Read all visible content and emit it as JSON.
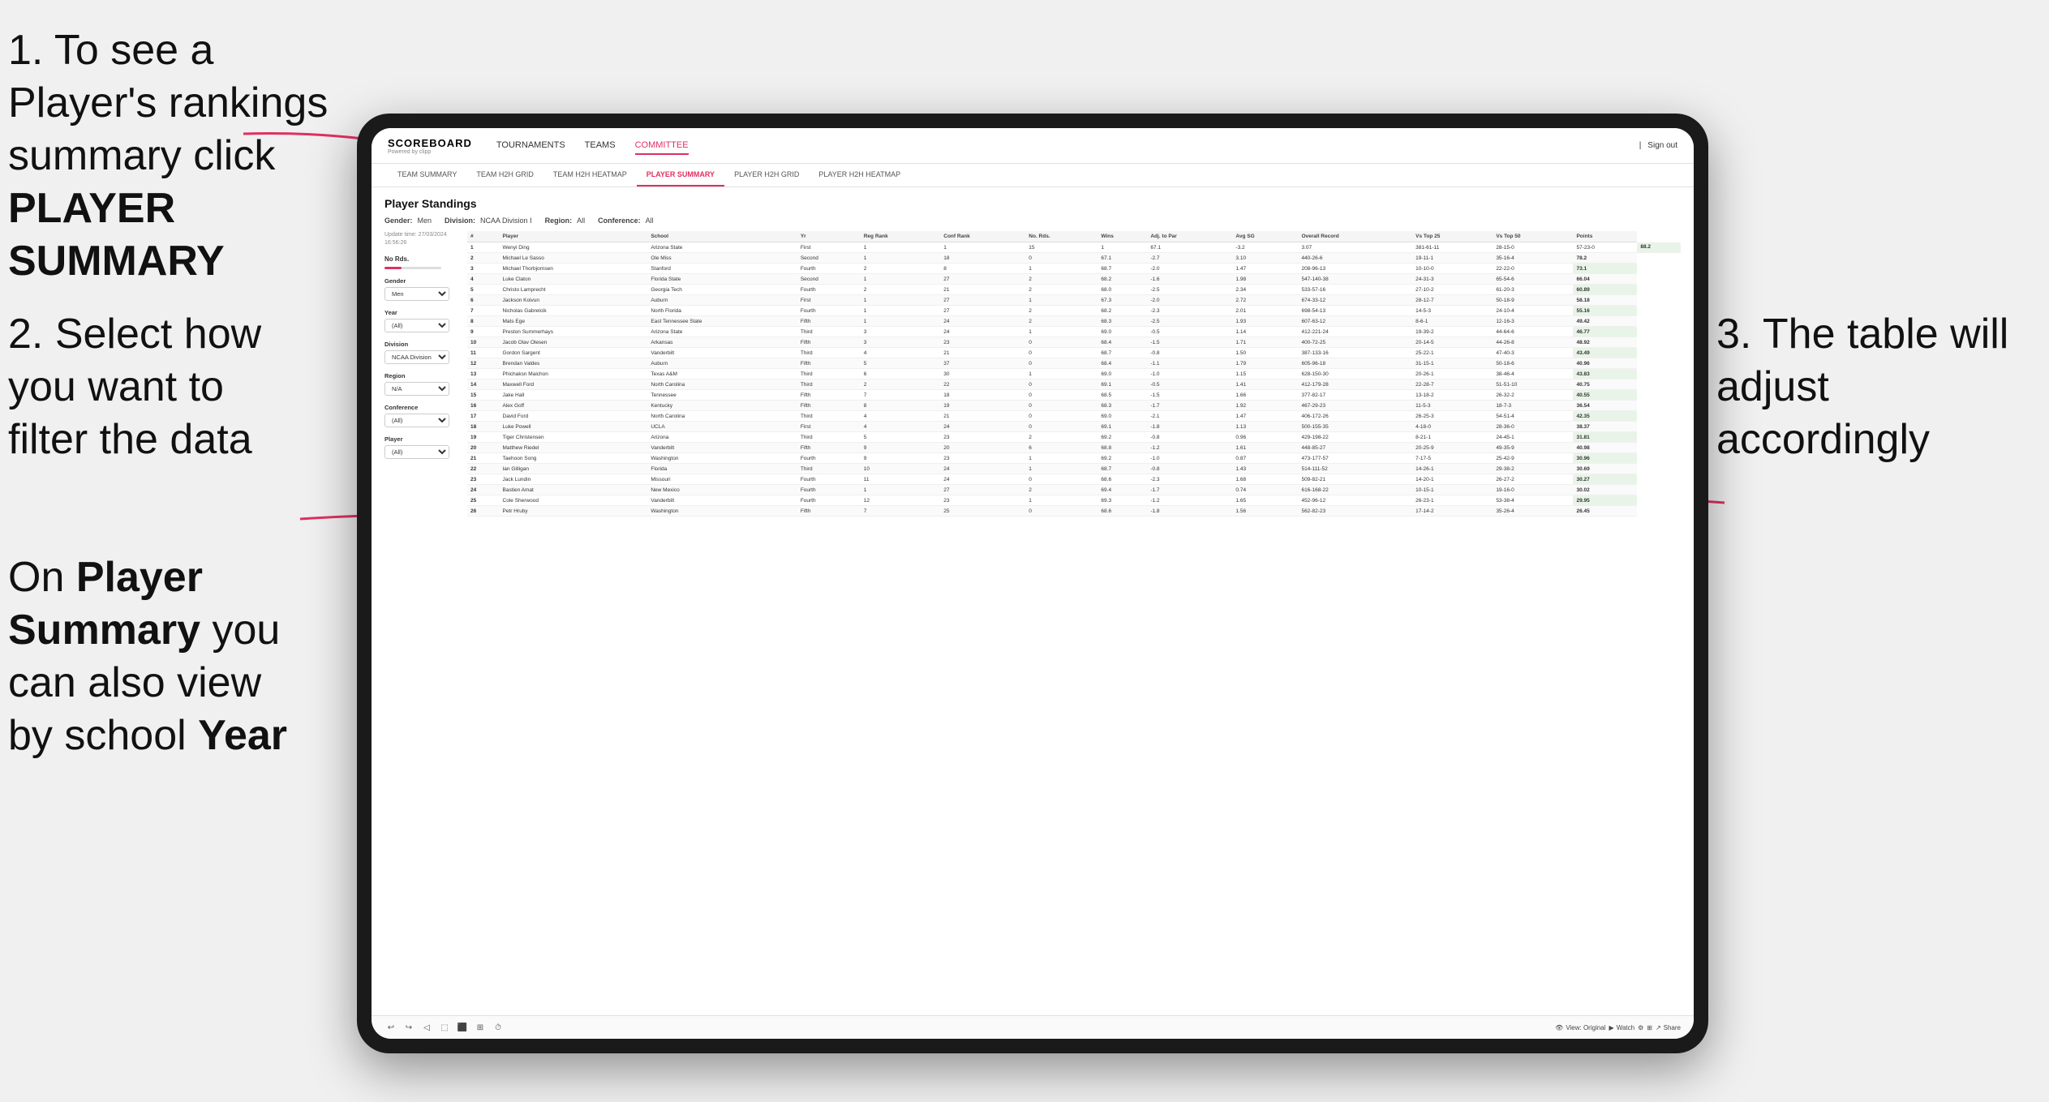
{
  "instructions": {
    "step1": {
      "number": "1.",
      "text": "To see a Player's rankings summary click ",
      "bold": "PLAYER SUMMARY"
    },
    "step2": {
      "number": "2.",
      "text": "Select how you want to filter the data"
    },
    "step3_sub": {
      "text": "On ",
      "bold1": "Player Summary",
      "text2": " you can also view by school ",
      "bold2": "Year"
    },
    "step_right": {
      "number": "3.",
      "text": "The table will adjust accordingly"
    }
  },
  "app": {
    "logo": "SCOREBOARD",
    "logo_sub": "Powered by clipp",
    "sign_out": "Sign out",
    "nav": [
      {
        "label": "TOURNAMENTS",
        "active": false
      },
      {
        "label": "TEAMS",
        "active": false
      },
      {
        "label": "COMMITTEE",
        "active": true
      }
    ],
    "sub_nav": [
      {
        "label": "TEAM SUMMARY",
        "active": false
      },
      {
        "label": "TEAM H2H GRID",
        "active": false
      },
      {
        "label": "TEAM H2H HEATMAP",
        "active": false
      },
      {
        "label": "PLAYER SUMMARY",
        "active": true
      },
      {
        "label": "PLAYER H2H GRID",
        "active": false
      },
      {
        "label": "PLAYER H2H HEATMAP",
        "active": false
      }
    ]
  },
  "page": {
    "title": "Player Standings",
    "filters_row": {
      "gender_label": "Gender:",
      "gender_value": "Men",
      "division_label": "Division:",
      "division_value": "NCAA Division I",
      "region_label": "Region:",
      "region_value": "All",
      "conference_label": "Conference:",
      "conference_value": "All"
    },
    "update_time": "Update time:\n27/03/2024 16:56:26",
    "sidebar": {
      "rds_label": "No Rds.",
      "gender_label": "Gender",
      "gender_value": "Men",
      "year_label": "Year",
      "year_value": "(All)",
      "division_label": "Division",
      "division_value": "NCAA Division I",
      "region_label": "Region",
      "region_value": "N/A",
      "conference_label": "Conference",
      "conference_value": "(All)",
      "player_label": "Player",
      "player_value": "(All)"
    },
    "table": {
      "headers": [
        "#",
        "Player",
        "School",
        "Yr",
        "Reg Rank",
        "Conf Rank",
        "No. Rds.",
        "Wins",
        "Adj. to Par",
        "Avg SG",
        "Overall Record",
        "Vs Top 25",
        "Vs Top 50",
        "Points"
      ],
      "rows": [
        [
          "1",
          "Wenyi Ding",
          "Arizona State",
          "First",
          "1",
          "1",
          "15",
          "1",
          "67.1",
          "-3.2",
          "3.07",
          "381-61-11",
          "28-15-0",
          "57-23-0",
          "88.2"
        ],
        [
          "2",
          "Michael Le Sasso",
          "Ole Miss",
          "Second",
          "1",
          "18",
          "0",
          "67.1",
          "-2.7",
          "3.10",
          "440-26-6",
          "19-11-1",
          "35-16-4",
          "78.2"
        ],
        [
          "3",
          "Michael Thorbjornsen",
          "Stanford",
          "Fourth",
          "2",
          "8",
          "1",
          "68.7",
          "-2.0",
          "1.47",
          "208-96-13",
          "10-10-0",
          "22-22-0",
          "73.1"
        ],
        [
          "4",
          "Luke Claton",
          "Florida State",
          "Second",
          "1",
          "27",
          "2",
          "68.2",
          "-1.6",
          "1.98",
          "547-140-38",
          "24-31-3",
          "65-54-6",
          "66.04"
        ],
        [
          "5",
          "Christo Lamprecht",
          "Georgia Tech",
          "Fourth",
          "2",
          "21",
          "2",
          "68.0",
          "-2.5",
          "2.34",
          "533-57-16",
          "27-10-2",
          "61-20-3",
          "60.89"
        ],
        [
          "6",
          "Jackson Koivun",
          "Auburn",
          "First",
          "1",
          "27",
          "1",
          "67.3",
          "-2.0",
          "2.72",
          "674-33-12",
          "28-12-7",
          "50-18-9",
          "58.18"
        ],
        [
          "7",
          "Nicholas Gabrelcik",
          "North Florida",
          "Fourth",
          "1",
          "27",
          "2",
          "68.2",
          "-2.3",
          "2.01",
          "698-54-13",
          "14-5-3",
          "24-10-4",
          "55.16"
        ],
        [
          "8",
          "Mats Ege",
          "East Tennessee State",
          "Fifth",
          "1",
          "24",
          "2",
          "68.3",
          "-2.5",
          "1.93",
          "607-63-12",
          "8-6-1",
          "12-16-3",
          "49.42"
        ],
        [
          "9",
          "Preston Summerhays",
          "Arizona State",
          "Third",
          "3",
          "24",
          "1",
          "69.0",
          "-0.5",
          "1.14",
          "412-221-24",
          "19-39-2",
          "44-64-6",
          "46.77"
        ],
        [
          "10",
          "Jacob Olav Olesen",
          "Arkansas",
          "Fifth",
          "3",
          "23",
          "0",
          "68.4",
          "-1.5",
          "1.71",
          "400-72-25",
          "20-14-5",
          "44-26-8",
          "48.92"
        ],
        [
          "11",
          "Gordon Sargent",
          "Vanderbilt",
          "Third",
          "4",
          "21",
          "0",
          "68.7",
          "-0.8",
          "1.50",
          "387-133-16",
          "25-22-1",
          "47-40-3",
          "43.49"
        ],
        [
          "12",
          "Brendan Valdes",
          "Auburn",
          "Fifth",
          "5",
          "37",
          "0",
          "68.4",
          "-1.1",
          "1.79",
          "605-96-18",
          "31-15-1",
          "50-18-6",
          "40.96"
        ],
        [
          "13",
          "Phichaksn Maichon",
          "Texas A&M",
          "Third",
          "6",
          "30",
          "1",
          "69.0",
          "-1.0",
          "1.15",
          "628-150-30",
          "20-26-1",
          "38-46-4",
          "43.83"
        ],
        [
          "14",
          "Maxwell Ford",
          "North Carolina",
          "Third",
          "2",
          "22",
          "0",
          "69.1",
          "-0.5",
          "1.41",
          "412-179-28",
          "22-28-7",
          "51-51-10",
          "40.75"
        ],
        [
          "15",
          "Jake Hall",
          "Tennessee",
          "Fifth",
          "7",
          "18",
          "0",
          "68.5",
          "-1.5",
          "1.66",
          "377-82-17",
          "13-18-2",
          "26-32-2",
          "40.55"
        ],
        [
          "16",
          "Alex Goff",
          "Kentucky",
          "Fifth",
          "8",
          "19",
          "0",
          "68.3",
          "-1.7",
          "1.92",
          "467-29-23",
          "11-5-3",
          "18-7-3",
          "36.54"
        ],
        [
          "17",
          "David Ford",
          "North Carolina",
          "Third",
          "4",
          "21",
          "0",
          "69.0",
          "-2.1",
          "1.47",
          "406-172-26",
          "26-25-3",
          "54-51-4",
          "42.35"
        ],
        [
          "18",
          "Luke Powell",
          "UCLA",
          "First",
          "4",
          "24",
          "0",
          "69.1",
          "-1.8",
          "1.13",
          "500-155-35",
          "4-18-0",
          "28-36-0",
          "38.37"
        ],
        [
          "19",
          "Tiger Christensen",
          "Arizona",
          "Third",
          "5",
          "23",
          "2",
          "69.2",
          "-0.8",
          "0.96",
          "429-198-22",
          "8-21-1",
          "24-45-1",
          "31.81"
        ],
        [
          "20",
          "Matthew Riedel",
          "Vanderbilt",
          "Fifth",
          "9",
          "20",
          "6",
          "68.8",
          "-1.2",
          "1.61",
          "448-85-27",
          "20-25-9",
          "49-35-9",
          "40.98"
        ],
        [
          "21",
          "Taehoon Song",
          "Washington",
          "Fourth",
          "9",
          "23",
          "1",
          "69.2",
          "-1.0",
          "0.87",
          "473-177-57",
          "7-17-5",
          "25-42-9",
          "30.96"
        ],
        [
          "22",
          "Ian Gilligan",
          "Florida",
          "Third",
          "10",
          "24",
          "1",
          "68.7",
          "-0.8",
          "1.43",
          "514-111-52",
          "14-26-1",
          "29-38-2",
          "30.69"
        ],
        [
          "23",
          "Jack Lundin",
          "Missouri",
          "Fourth",
          "11",
          "24",
          "0",
          "68.6",
          "-2.3",
          "1.68",
          "509-82-21",
          "14-20-1",
          "26-27-2",
          "30.27"
        ],
        [
          "24",
          "Bastien Amat",
          "New Mexico",
          "Fourth",
          "1",
          "27",
          "2",
          "69.4",
          "-1.7",
          "0.74",
          "616-168-22",
          "10-15-1",
          "19-16-0",
          "30.02"
        ],
        [
          "25",
          "Cole Sherwood",
          "Vanderbilt",
          "Fourth",
          "12",
          "23",
          "1",
          "69.3",
          "-1.2",
          "1.65",
          "452-96-12",
          "26-23-1",
          "53-38-4",
          "29.95"
        ],
        [
          "26",
          "Petr Hruby",
          "Washington",
          "Fifth",
          "7",
          "25",
          "0",
          "68.6",
          "-1.8",
          "1.56",
          "562-82-23",
          "17-14-2",
          "35-26-4",
          "26.45"
        ]
      ]
    },
    "toolbar": {
      "view_label": "View: Original",
      "watch_label": "Watch",
      "share_label": "Share"
    }
  }
}
